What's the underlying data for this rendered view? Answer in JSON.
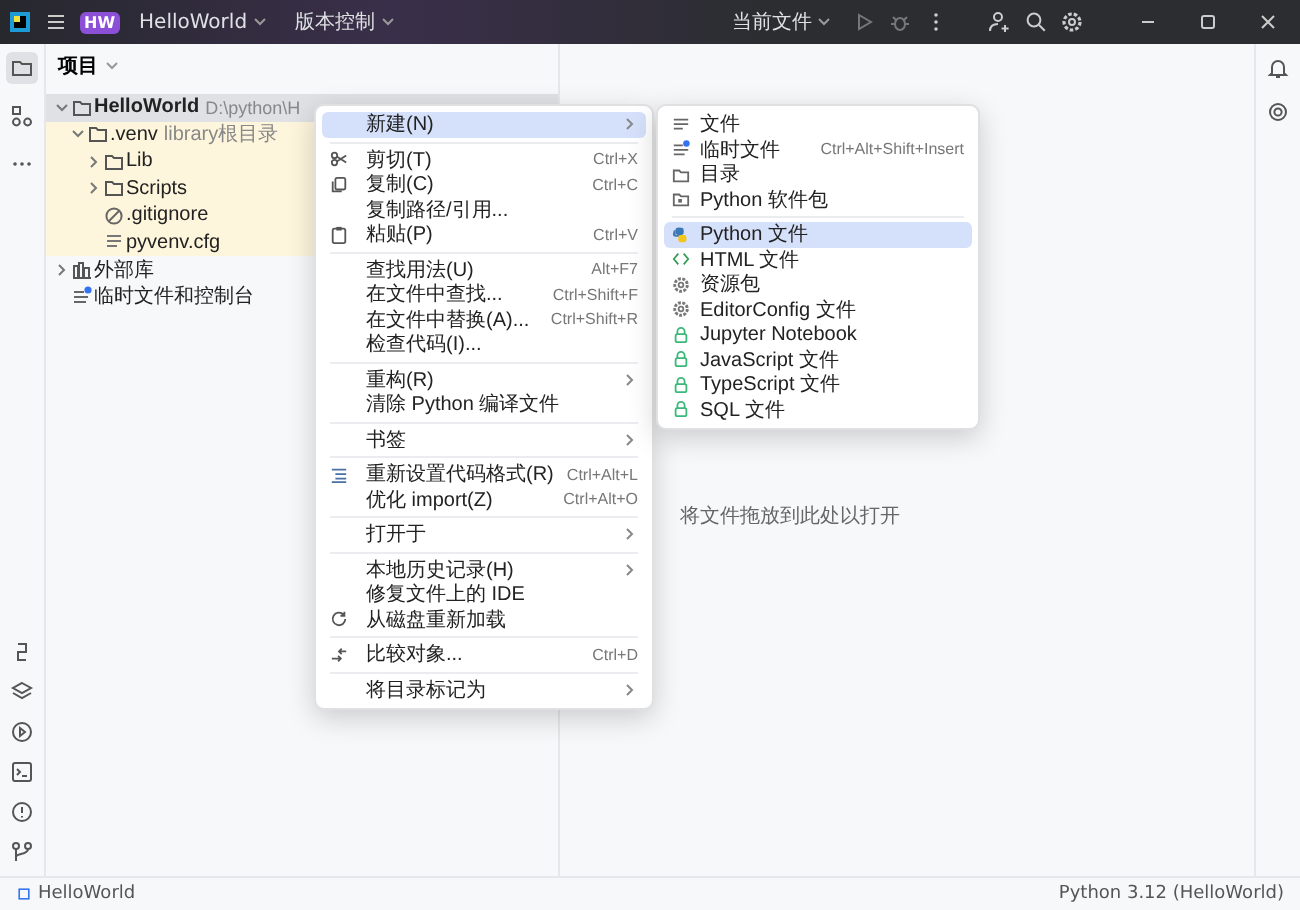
{
  "title_bar": {
    "project_badge": "HW",
    "project": "HelloWorld",
    "vcs": "版本控制",
    "run_config": "当前文件"
  },
  "left_tools": [
    {
      "selected": true
    },
    {
      "selected": false
    },
    {
      "selected": false
    }
  ],
  "project_panel": {
    "title": "项目",
    "tree": [
      {
        "name": "HelloWorld",
        "path": "D:\\python\\H",
        "kind": "folder",
        "expanded": true,
        "selected": true,
        "excluded": false,
        "children": [
          {
            "name": ".venv",
            "note": "library根目录",
            "kind": "folder",
            "expanded": true,
            "selected": false,
            "excluded": true,
            "children": [
              {
                "name": "Lib",
                "kind": "folder",
                "expanded": false,
                "selected": false,
                "excluded": true
              },
              {
                "name": "Scripts",
                "kind": "folder",
                "expanded": false,
                "selected": false,
                "excluded": true
              },
              {
                "name": ".gitignore",
                "kind": "ignore",
                "selected": false,
                "excluded": true
              },
              {
                "name": "pyvenv.cfg",
                "kind": "text",
                "selected": false,
                "excluded": true
              }
            ]
          }
        ]
      },
      {
        "name": "外部库",
        "kind": "library",
        "expanded": false,
        "selected": false,
        "excluded": false
      },
      {
        "name": "临时文件和控制台",
        "kind": "scratch",
        "selected": false,
        "excluded": false
      }
    ]
  },
  "editor": {
    "hint": "将文件拖放到此处以打开"
  },
  "context_menu": {
    "groups": [
      [
        {
          "label": "新建(N)",
          "submenu": true,
          "selected": true
        }
      ],
      [
        {
          "label": "剪切(T)",
          "shortcut": "Ctrl+X",
          "submenu": false,
          "selected": false
        },
        {
          "label": "复制(C)",
          "shortcut": "Ctrl+C",
          "submenu": false,
          "selected": false
        },
        {
          "label": "复制路径/引用...",
          "submenu": false,
          "selected": false
        },
        {
          "label": "粘贴(P)",
          "shortcut": "Ctrl+V",
          "submenu": false,
          "selected": false
        }
      ],
      [
        {
          "label": "查找用法(U)",
          "shortcut": "Alt+F7",
          "submenu": false,
          "selected": false
        },
        {
          "label": "在文件中查找...",
          "shortcut": "Ctrl+Shift+F",
          "submenu": false,
          "selected": false
        },
        {
          "label": "在文件中替换(A)...",
          "shortcut": "Ctrl+Shift+R",
          "submenu": false,
          "selected": false
        },
        {
          "label": "检查代码(I)...",
          "submenu": false,
          "selected": false
        }
      ],
      [
        {
          "label": "重构(R)",
          "submenu": true,
          "selected": false
        },
        {
          "label": "清除 Python 编译文件",
          "submenu": false,
          "selected": false
        }
      ],
      [
        {
          "label": "书签",
          "submenu": true,
          "selected": false
        }
      ],
      [
        {
          "label": "重新设置代码格式(R)",
          "shortcut": "Ctrl+Alt+L",
          "submenu": false,
          "selected": false
        },
        {
          "label": "优化 import(Z)",
          "shortcut": "Ctrl+Alt+O",
          "submenu": false,
          "selected": false
        }
      ],
      [
        {
          "label": "打开于",
          "submenu": true,
          "selected": false
        }
      ],
      [
        {
          "label": "本地历史记录(H)",
          "submenu": true,
          "selected": false
        },
        {
          "label": "修复文件上的 IDE",
          "submenu": false,
          "selected": false
        },
        {
          "label": "从磁盘重新加载",
          "submenu": false,
          "selected": false
        }
      ],
      [
        {
          "label": "比较对象...",
          "shortcut": "Ctrl+D",
          "submenu": false,
          "selected": false
        }
      ],
      [
        {
          "label": "将目录标记为",
          "submenu": true,
          "selected": false
        }
      ]
    ]
  },
  "new_submenu": {
    "groups": [
      [
        {
          "label": "文件",
          "selected": false
        },
        {
          "label": "临时文件",
          "shortcut": "Ctrl+Alt+Shift+Insert",
          "selected": false
        },
        {
          "label": "目录",
          "selected": false
        },
        {
          "label": "Python 软件包",
          "selected": false
        }
      ],
      [
        {
          "label": "Python 文件",
          "selected": true
        },
        {
          "label": "HTML 文件",
          "selected": false
        },
        {
          "label": "资源包",
          "selected": false
        },
        {
          "label": "EditorConfig 文件",
          "selected": false
        },
        {
          "label": "Jupyter Notebook",
          "selected": false
        },
        {
          "label": "JavaScript 文件",
          "selected": false
        },
        {
          "label": "TypeScript 文件",
          "selected": false
        },
        {
          "label": "SQL 文件",
          "selected": false
        }
      ]
    ]
  },
  "status_bar": {
    "project": "HelloWorld",
    "interpreter": "Python 3.12 (HelloWorld)"
  }
}
